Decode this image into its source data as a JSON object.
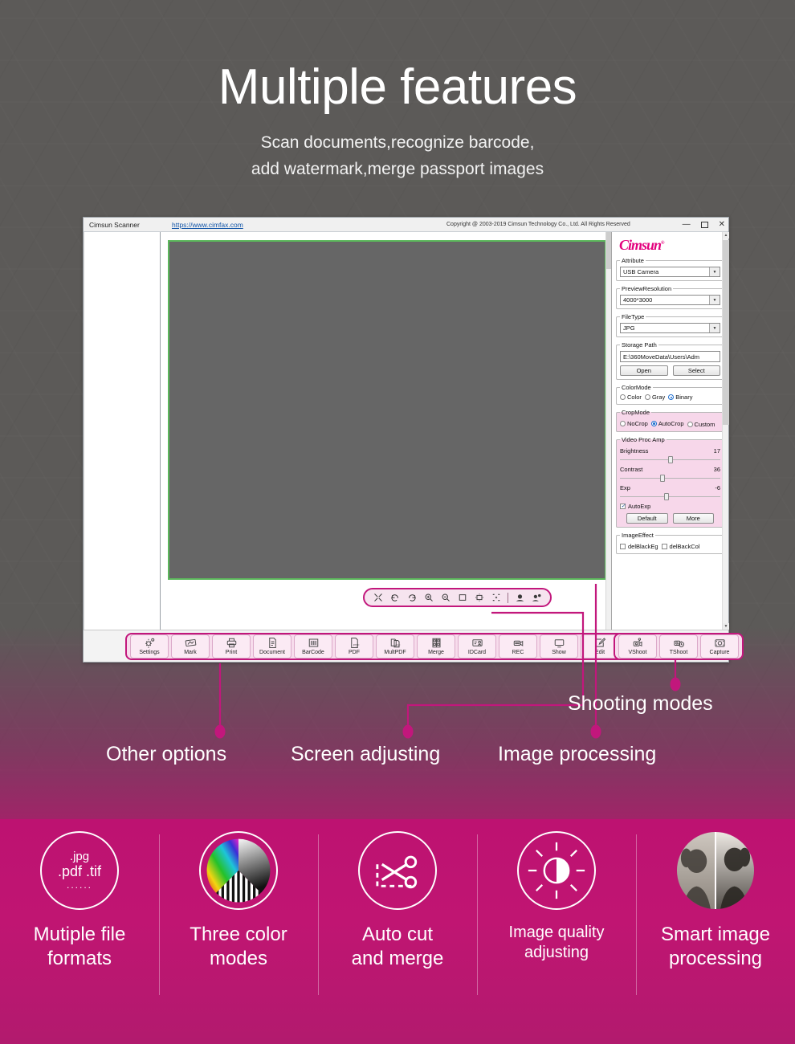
{
  "hero": {
    "title": "Multiple features",
    "subtitle_line1": "Scan documents,recognize barcode,",
    "subtitle_line2": "add watermark,merge passport images"
  },
  "app_window": {
    "titlebar": {
      "app_name": "Cimsun Scanner",
      "url": "https://www.cimfax.com",
      "copyright": "Copyright @ 2003-2019   Cimsun Technology Co., Ltd. All Rights Reserved",
      "minimize": "—",
      "maximize": "□",
      "close": "✕"
    },
    "screen_toolbar": {
      "icons": [
        "fullscreen-icon",
        "rotate-left-icon",
        "rotate-right-icon",
        "zoom-in-icon",
        "zoom-out-icon",
        "fit-screen-icon",
        "center-icon",
        "select-area-icon",
        "camera-icon",
        "multi-camera-icon"
      ]
    },
    "sidebar": {
      "logo": "Cimsun",
      "logo_mark": "®",
      "attribute": {
        "legend": "Attribute",
        "value": "USB Camera"
      },
      "preview_resolution": {
        "legend": "PreviewResolution",
        "value": "4000*3000"
      },
      "file_type": {
        "legend": "FileType",
        "value": "JPG"
      },
      "storage_path": {
        "legend": "Storage Path",
        "value": "E:\\360MoveData\\Users\\Adm",
        "open_label": "Open",
        "select_label": "Select"
      },
      "color_mode": {
        "legend": "ColorMode",
        "options": [
          "Color",
          "Gray",
          "Binary"
        ],
        "selected": "Binary"
      },
      "crop_mode": {
        "legend": "CropMode",
        "options": [
          "NoCrop",
          "AutoCrop",
          "Custom"
        ],
        "selected": "AutoCrop"
      },
      "video_proc_amp": {
        "legend": "Video Proc Amp",
        "sliders": [
          {
            "label": "Brightness",
            "value": "17",
            "pos": 48
          },
          {
            "label": "Contrast",
            "value": "36",
            "pos": 40
          },
          {
            "label": "Exp",
            "value": "-6",
            "pos": 44
          }
        ],
        "auto_exp_label": "AutoExp",
        "auto_exp_checked": true,
        "default_label": "Default",
        "more_label": "More"
      },
      "image_effect": {
        "legend": "ImageEffect",
        "options": [
          "delBlackEg",
          "delBackCol"
        ]
      }
    },
    "toolbar_left": [
      {
        "label": "Settings",
        "icon": "gear-icon"
      },
      {
        "label": "Mark",
        "icon": "watermark-icon"
      },
      {
        "label": "Print",
        "icon": "printer-icon"
      },
      {
        "label": "Document",
        "icon": "document-icon"
      },
      {
        "label": "BarCode",
        "icon": "barcode-icon"
      },
      {
        "label": "PDF",
        "icon": "pdf-icon"
      },
      {
        "label": "MultPDF",
        "icon": "multi-pdf-icon"
      },
      {
        "label": "Merge",
        "icon": "merge-icon"
      },
      {
        "label": "IDCard",
        "icon": "idcard-icon"
      },
      {
        "label": "REC",
        "icon": "video-record-icon"
      },
      {
        "label": "Show",
        "icon": "monitor-icon"
      },
      {
        "label": "Edit",
        "icon": "pencil-edit-icon"
      }
    ],
    "toolbar_right": [
      {
        "label": "VShoot",
        "icon": "video-shoot-icon"
      },
      {
        "label": "TShoot",
        "icon": "timer-shoot-icon"
      },
      {
        "label": "Capture",
        "icon": "capture-icon"
      }
    ]
  },
  "callouts": [
    {
      "label": "Other options"
    },
    {
      "label": "Screen adjusting"
    },
    {
      "label": "Image processing"
    },
    {
      "label": "Shooting modes"
    }
  ],
  "features": [
    {
      "icon": "file-formats-icon",
      "fmt_a": ".jpg",
      "fmt_b": ".pdf .tif",
      "fmt_c": "......",
      "caption_line1": "Mutiple file",
      "caption_line2": "formats",
      "size": "big"
    },
    {
      "icon": "color-modes-icon",
      "caption_line1": "Three color",
      "caption_line2": "modes",
      "size": "big"
    },
    {
      "icon": "auto-cut-scissors-icon",
      "caption_line1": "Auto cut",
      "caption_line2": "and merge",
      "size": "big"
    },
    {
      "icon": "brightness-contrast-icon",
      "caption_line1": "Image quality",
      "caption_line2": "adjusting",
      "size": "small"
    },
    {
      "icon": "smart-image-processing-icon",
      "caption_line1": "Smart image",
      "caption_line2": "processing",
      "size": "big"
    }
  ],
  "colors": {
    "accent": "#c2177c",
    "magenta_bg": "#bd1271",
    "dark_bg": "#5c5a58",
    "preview_border": "#5cb85c",
    "link": "#1255a8"
  }
}
